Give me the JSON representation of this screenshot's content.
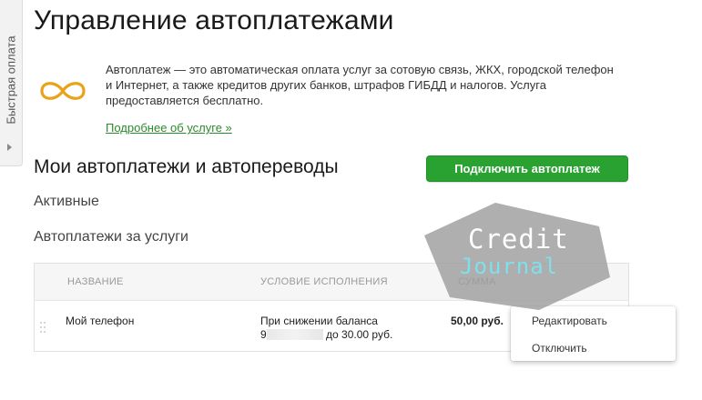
{
  "side_tab": {
    "label": "Быстрая оплата"
  },
  "page": {
    "title": "Управление автоплатежами"
  },
  "intro": {
    "text": "Автоплатеж — это автоматическая оплата услуг за сотовую связь, ЖКХ, городской телефон и Интернет, а также кредитов других банков, штрафов ГИБДД и налогов. Услуга предоставляется бесплатно.",
    "more_link": "Подробнее об услуге »",
    "icon": "infinity-icon",
    "icon_color": "#e9a31b"
  },
  "section": {
    "title": "Мои автоплатежи и автопереводы",
    "connect_button": "Подключить автоплатеж",
    "active_label": "Активные",
    "services_label": "Автоплатежи за услуги"
  },
  "table": {
    "columns": [
      "НАЗВАНИЕ",
      "УСЛОВИЕ ИСПОЛНЕНИЯ",
      "СУММА"
    ],
    "rows": [
      {
        "name": "Мой телефон",
        "condition_line1": "При снижении баланса",
        "condition_prefix": "9",
        "condition_suffix": "до 30.00 руб.",
        "amount": "50,00 руб."
      }
    ]
  },
  "menu": {
    "edit": "Редактировать",
    "disable": "Отключить"
  },
  "watermark": {
    "word1": "Credit",
    "word2": "Journal"
  },
  "colors": {
    "accent_green": "#2aa232",
    "link_green": "#2b8a2b",
    "watermark_gray": "#9e9e9e"
  }
}
